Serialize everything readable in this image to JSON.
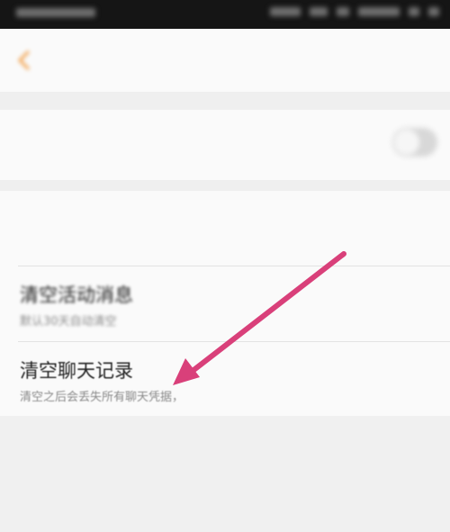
{
  "status_bar": {
    "left_text": "",
    "right_text": ""
  },
  "nav": {
    "title": ""
  },
  "settings": {
    "toggle_label": ""
  },
  "list": {
    "items": [
      {
        "title": "",
        "subtitle": ""
      },
      {
        "title": "清空活动消息",
        "subtitle": "默认30天自动清空"
      },
      {
        "title": "清空聊天记录",
        "subtitle": "清空之后会丢失所有聊天凭据，",
        "subtitle_tail": ""
      }
    ]
  },
  "colors": {
    "back_icon": "#f2a04a",
    "annotation_arrow": "#d9407a",
    "status_bar_bg": "#151515"
  },
  "icons": {
    "back": "chevron-left-icon",
    "annotation": "arrow-icon"
  }
}
